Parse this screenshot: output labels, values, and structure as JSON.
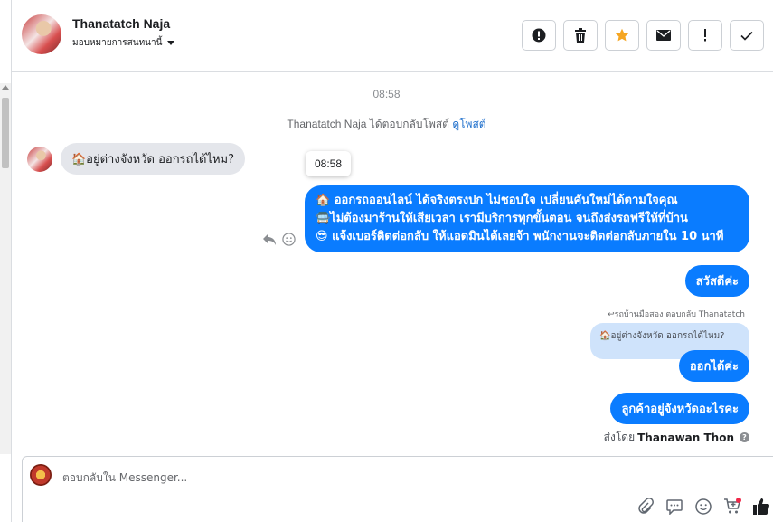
{
  "header": {
    "user_name": "Thanatatch Naja",
    "assign_label": "มอบหมายการสนทนานี้",
    "actions": [
      {
        "label": "Mark as spam",
        "icon": "alert-circle-icon"
      },
      {
        "label": "Delete",
        "icon": "trash-icon"
      },
      {
        "label": "Star",
        "icon": "star-icon"
      },
      {
        "label": "Mark unread",
        "icon": "envelope-icon"
      },
      {
        "label": "Important",
        "icon": "exclamation-icon"
      },
      {
        "label": "Done",
        "icon": "checkmark-icon"
      }
    ]
  },
  "conversation": {
    "top_time": "08:58",
    "reply_note_prefix": "Thanatatch Naja ได้ตอบกลับโพสต์",
    "reply_note_link": "ดูโพสต์",
    "incoming_message": "🏠อยู่ต่างจังหวัด ออกรถได้ไหม?",
    "tooltip_time": "08:58",
    "outgoing_big": [
      "🏠 ออกรถออนไลน์ ได้จริงตรงปก ไม่ชอบใจ เปลี่ยนคันใหม่ได้ตามใจคุณ",
      "🚍ไม่ต้องมาร้านให้เสียเวลา เรามีบริการทุกขั้นตอน จนถึงส่งรถฟรีให้ที่บ้าน",
      "😎 แจ้งเบอร์ติดต่อกลับ ให้แอดมินได้เลยจ้า พนักงานจะติดต่อกลับภายใน 10 นาที"
    ],
    "greeting": "สวัสดีค่ะ",
    "reply_meta": "↩รถบ้านมือสอง ตอบกลับ Thanatatch",
    "quoted_text": "🏠อยู่ต่างจังหวัด ออกรถได้ไหม?",
    "answer": "ออกได้ค่ะ",
    "question": "ลูกค้าอยู่จังหวัดอะไรคะ",
    "sent_by_label": "ส่งโดย",
    "sent_by_name": "Thanawan Thon"
  },
  "composer": {
    "placeholder": "ตอบกลับใน Messenger..."
  },
  "colors": {
    "accent": "#0a7cff",
    "star": "#f5a623"
  }
}
